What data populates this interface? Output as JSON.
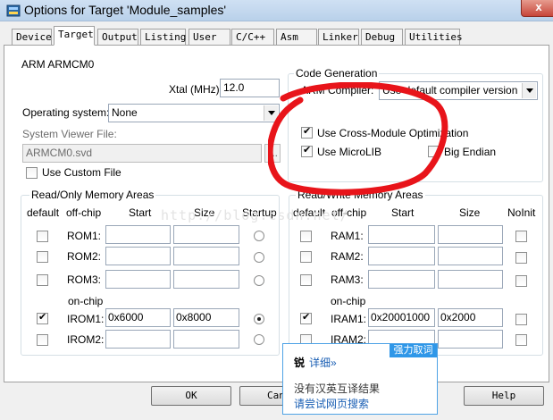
{
  "window": {
    "title": "Options for Target 'Module_samples'",
    "close_glyph": "x"
  },
  "tabs": [
    "Device",
    "Target",
    "Output",
    "Listing",
    "User",
    "C/C++",
    "Asm",
    "Linker",
    "Debug",
    "Utilities"
  ],
  "active_tab": "Target",
  "target": {
    "device_name": "ARM ARMCM0",
    "xtal_label": "Xtal (MHz):",
    "xtal_value": "12.0",
    "os_label": "Operating system:",
    "os_value": "None",
    "svd_label": "System Viewer File:",
    "svd_value": "ARMCM0.svd",
    "svd_browse": "...",
    "custom_file_label": "Use Custom File"
  },
  "codegen": {
    "title": "Code Generation",
    "compiler_label": "ARM Compiler:",
    "compiler_value": "Use default compiler version",
    "cross_module_label": "Use Cross-Module Optimization",
    "cross_module_checked": true,
    "microlib_label": "Use MicroLIB",
    "microlib_checked": true,
    "big_endian_label": "Big Endian",
    "big_endian_checked": false
  },
  "rom": {
    "title": "Read/Only Memory Areas",
    "headers": {
      "default": "default",
      "offchip": "off-chip",
      "start": "Start",
      "size": "Size",
      "startup": "Startup"
    },
    "onchip_label": "on-chip",
    "rows": [
      {
        "name": "ROM1:",
        "start": "",
        "size": ""
      },
      {
        "name": "ROM2:",
        "start": "",
        "size": ""
      },
      {
        "name": "ROM3:",
        "start": "",
        "size": ""
      },
      {
        "name": "IROM1:",
        "start": "0x6000",
        "size": "0x8000"
      },
      {
        "name": "IROM2:",
        "start": "",
        "size": ""
      }
    ]
  },
  "ram": {
    "title": "Read/Write Memory Areas",
    "headers": {
      "default": "default",
      "offchip": "off-chip",
      "start": "Start",
      "size": "Size",
      "noinit": "NoInit"
    },
    "onchip_label": "on-chip",
    "rows": [
      {
        "name": "RAM1:",
        "start": "",
        "size": ""
      },
      {
        "name": "RAM2:",
        "start": "",
        "size": ""
      },
      {
        "name": "RAM3:",
        "start": "",
        "size": ""
      },
      {
        "name": "IRAM1:",
        "start": "0x20001000",
        "size": "0x2000"
      },
      {
        "name": "IRAM2:",
        "start": "",
        "size": ""
      }
    ]
  },
  "buttons": {
    "ok": "OK",
    "cancel": "Can",
    "help": "Help"
  },
  "watermark": "http://blog.csdn.net/",
  "popup": {
    "header": "强力取词",
    "word": "锐",
    "details_link": "详细»",
    "no_result": "没有汉英互译结果",
    "web_search": "请尝试网页搜索"
  },
  "colors": {
    "annotation": "#e8141a",
    "popup_accent": "#2f97e8"
  }
}
